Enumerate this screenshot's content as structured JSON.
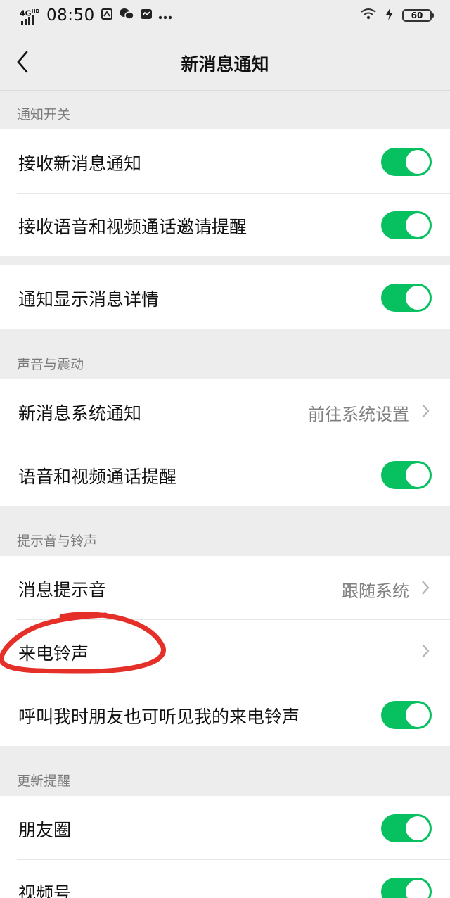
{
  "status_bar": {
    "network": "4G",
    "network_sup": "HD",
    "time": "08:50",
    "battery": "60",
    "icons": [
      "sim-icon",
      "wechat-icon",
      "message-icon",
      "more-icon",
      "wifi-icon",
      "charging-icon"
    ]
  },
  "nav": {
    "title": "新消息通知"
  },
  "sections": {
    "notify_switch": "通知开关",
    "sound_vibrate": "声音与震动",
    "tone_ringtone": "提示音与铃声",
    "update_reminder": "更新提醒"
  },
  "rows": {
    "receive_new": "接收新消息通知",
    "receive_call_invite": "接收语音和视频通话邀请提醒",
    "show_details": "通知显示消息详情",
    "system_notify": "新消息系统通知",
    "system_notify_value": "前往系统设置",
    "call_reminder": "语音和视频通话提醒",
    "message_tone": "消息提示音",
    "message_tone_value": "跟随系统",
    "ringtone": "来电铃声",
    "friend_hear_ringtone": "呼叫我时朋友也可听见我的来电铃声",
    "moments": "朋友圈",
    "channels": "视频号"
  },
  "toggles": {
    "receive_new": true,
    "receive_call_invite": true,
    "show_details": true,
    "call_reminder": true,
    "friend_hear_ringtone": true,
    "moments": true,
    "channels": true
  },
  "colors": {
    "toggle_on": "#07c160",
    "annotation": "#e5302a",
    "background": "#ededed"
  }
}
